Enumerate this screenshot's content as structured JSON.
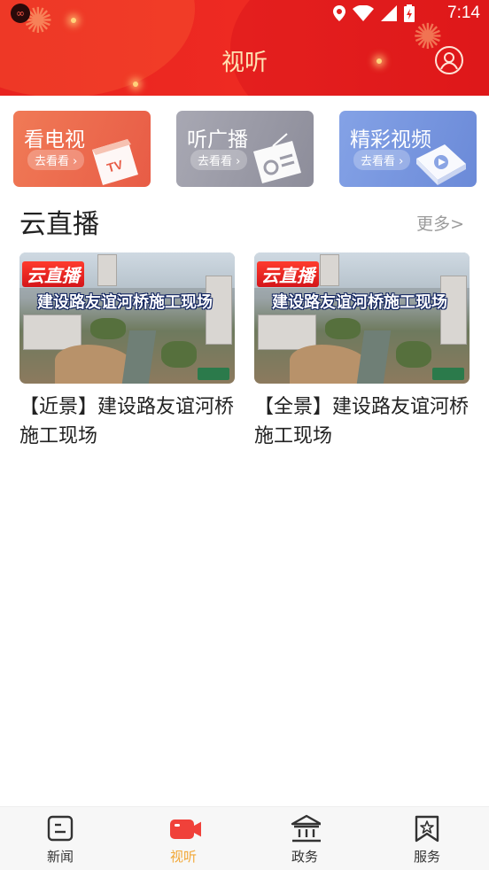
{
  "status_bar": {
    "time": "7:14"
  },
  "header": {
    "title": "视听"
  },
  "shortcuts": [
    {
      "title": "看电视",
      "sub": "去看看 ›",
      "art": "tv"
    },
    {
      "title": "听广播",
      "sub": "去看看 ›",
      "art": "radio"
    },
    {
      "title": "精彩视频",
      "sub": "去看看 ›",
      "art": "play"
    }
  ],
  "section": {
    "title": "云直播",
    "more": "更多>"
  },
  "videos": [
    {
      "tag": "云直播",
      "caption": "建设路友谊河桥施工现场",
      "title": "【近景】建设路友谊河桥施工现场"
    },
    {
      "tag": "云直播",
      "caption": "建设路友谊河桥施工现场",
      "title": "【全景】建设路友谊河桥施工现场"
    }
  ],
  "bottom_nav": [
    {
      "label": "新闻",
      "icon": "news-icon",
      "active": false
    },
    {
      "label": "视听",
      "icon": "video-camera-icon",
      "active": true
    },
    {
      "label": "政务",
      "icon": "government-building-icon",
      "active": false
    },
    {
      "label": "服务",
      "icon": "service-bookmark-icon",
      "active": false
    }
  ],
  "colors": {
    "header_red": "#e8231f",
    "accent_orange": "#f2a838",
    "nav_active_icon": "#f0413a"
  }
}
